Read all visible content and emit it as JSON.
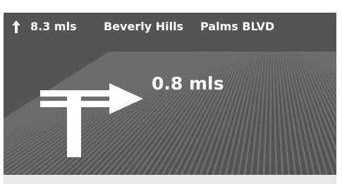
{
  "status_bar": {
    "heading_icon": "up-arrow-icon",
    "distance_to_destination": "8.3 mls",
    "city": "Beverly Hills",
    "street": "Palms BLVD"
  },
  "maneuver": {
    "icon": "turn-right-arrow-icon",
    "distance_to_turn": "0.8 mls"
  },
  "colors": {
    "background": "#545454",
    "road_stripes": "#6d6d6d",
    "text": "#ffffff"
  }
}
